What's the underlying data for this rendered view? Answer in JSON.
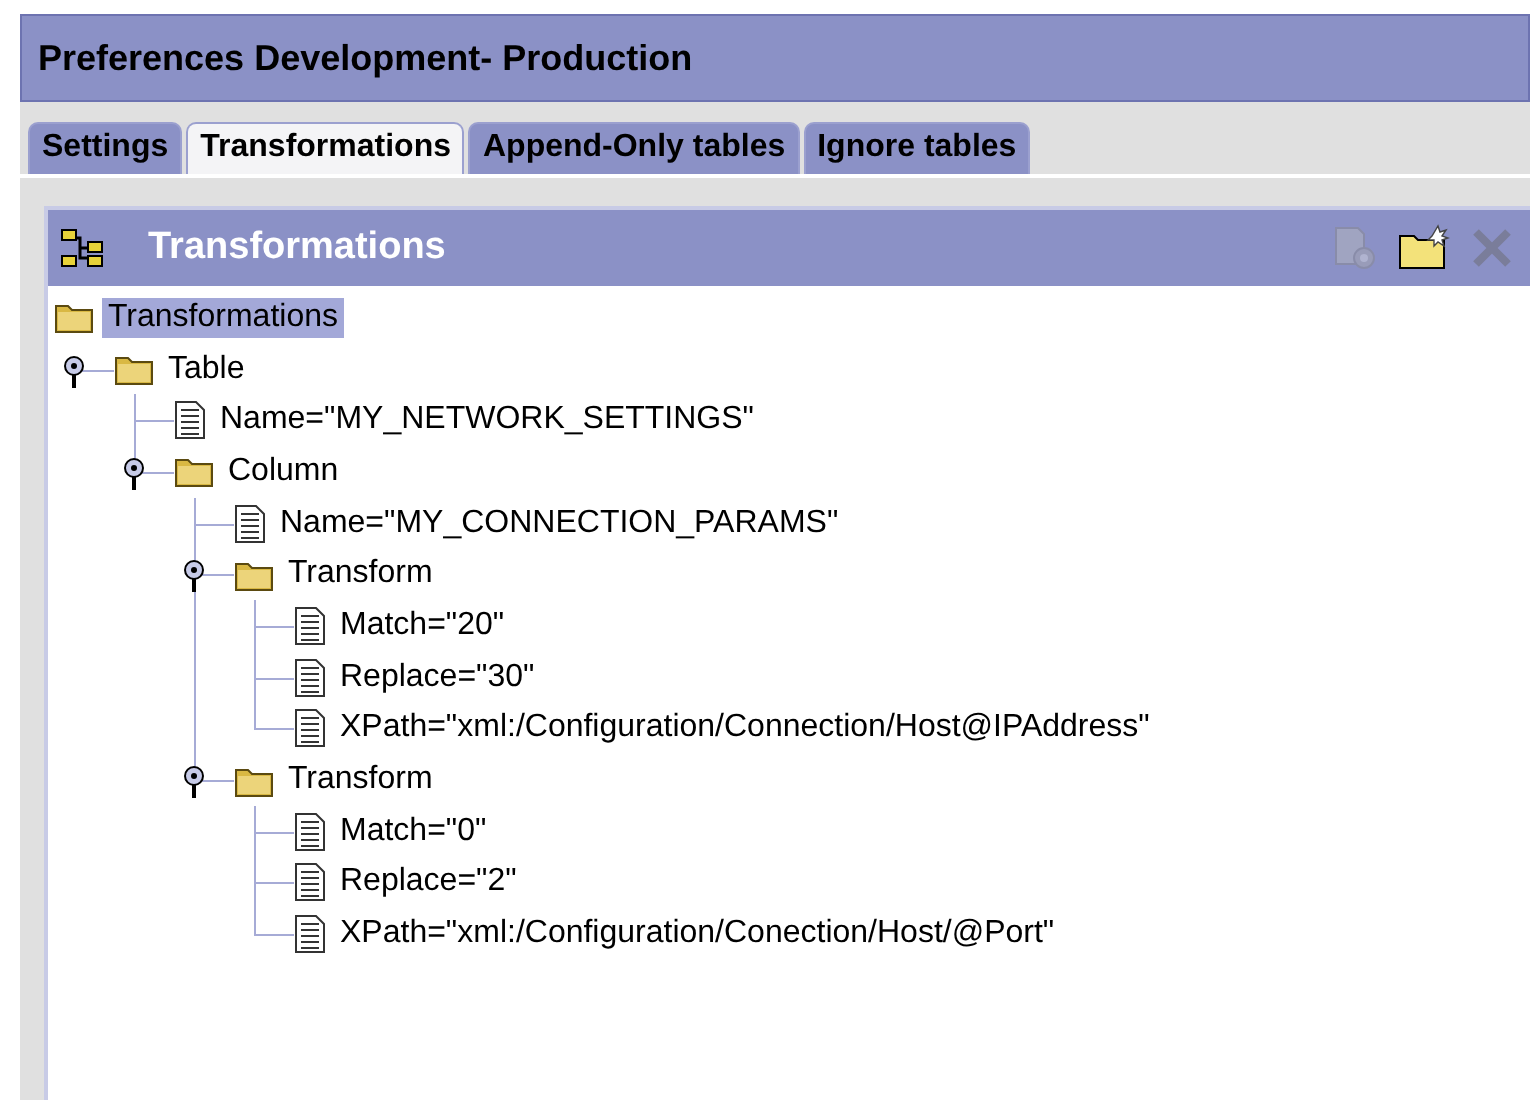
{
  "window": {
    "title": "Preferences Development- Production"
  },
  "tabs": [
    {
      "label": "Settings",
      "selected": false
    },
    {
      "label": "Transformations",
      "selected": true
    },
    {
      "label": "Append-Only tables",
      "selected": false
    },
    {
      "label": "Ignore tables",
      "selected": false
    }
  ],
  "panel": {
    "title": "Transformations",
    "toolbar": [
      {
        "kind": "properties",
        "disabled": true
      },
      {
        "kind": "new-folder",
        "disabled": false
      },
      {
        "kind": "delete",
        "disabled": true
      }
    ]
  },
  "tree": {
    "label": "Transformations",
    "kind": "folder",
    "selected": true,
    "children": [
      {
        "label": "Table",
        "kind": "folder",
        "selected": false,
        "expanded": true,
        "children": [
          {
            "label": "Name=\"MY_NETWORK_SETTINGS\"",
            "kind": "file",
            "selected": false
          },
          {
            "label": "Column",
            "kind": "folder",
            "selected": false,
            "expanded": true,
            "children": [
              {
                "label": "Name=\"MY_CONNECTION_PARAMS\"",
                "kind": "file",
                "selected": false
              },
              {
                "label": "Transform",
                "kind": "folder",
                "selected": false,
                "expanded": true,
                "children": [
                  {
                    "label": "Match=\"20\"",
                    "kind": "file",
                    "selected": false
                  },
                  {
                    "label": "Replace=\"30\"",
                    "kind": "file",
                    "selected": false
                  },
                  {
                    "label": "XPath=\"xml:/Configuration/Connection/Host@IPAddress\"",
                    "kind": "file",
                    "selected": false
                  }
                ]
              },
              {
                "label": "Transform",
                "kind": "folder",
                "selected": false,
                "expanded": true,
                "children": [
                  {
                    "label": "Match=\"0\"",
                    "kind": "file",
                    "selected": false
                  },
                  {
                    "label": "Replace=\"2\"",
                    "kind": "file",
                    "selected": false
                  },
                  {
                    "label": "XPath=\"xml:/Configuration/Conection/Host/@Port\"",
                    "kind": "file",
                    "selected": false
                  }
                ]
              }
            ]
          }
        ]
      }
    ]
  }
}
